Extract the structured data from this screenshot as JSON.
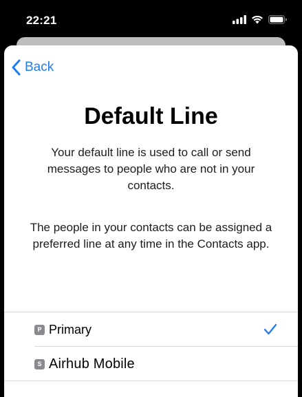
{
  "status_bar": {
    "time": "22:21",
    "icons": [
      "signal-icon",
      "wifi-icon",
      "battery-icon"
    ]
  },
  "nav": {
    "back_label": "Back"
  },
  "page": {
    "title": "Default Line",
    "description_1": "Your default line is used to call or send messages to people who are not in your contacts.",
    "description_2": "The people in your contacts can be assigned a preferred line at any time in the Contacts app."
  },
  "lines": [
    {
      "badge": "P",
      "label": "Primary",
      "selected": true
    },
    {
      "badge": "S",
      "label": "Airhub Mobile",
      "selected": false
    }
  ],
  "colors": {
    "accent": "#1f7cf2",
    "badge": "#8a8a8e",
    "background": "#ffffff",
    "status_bar": "#000000"
  }
}
